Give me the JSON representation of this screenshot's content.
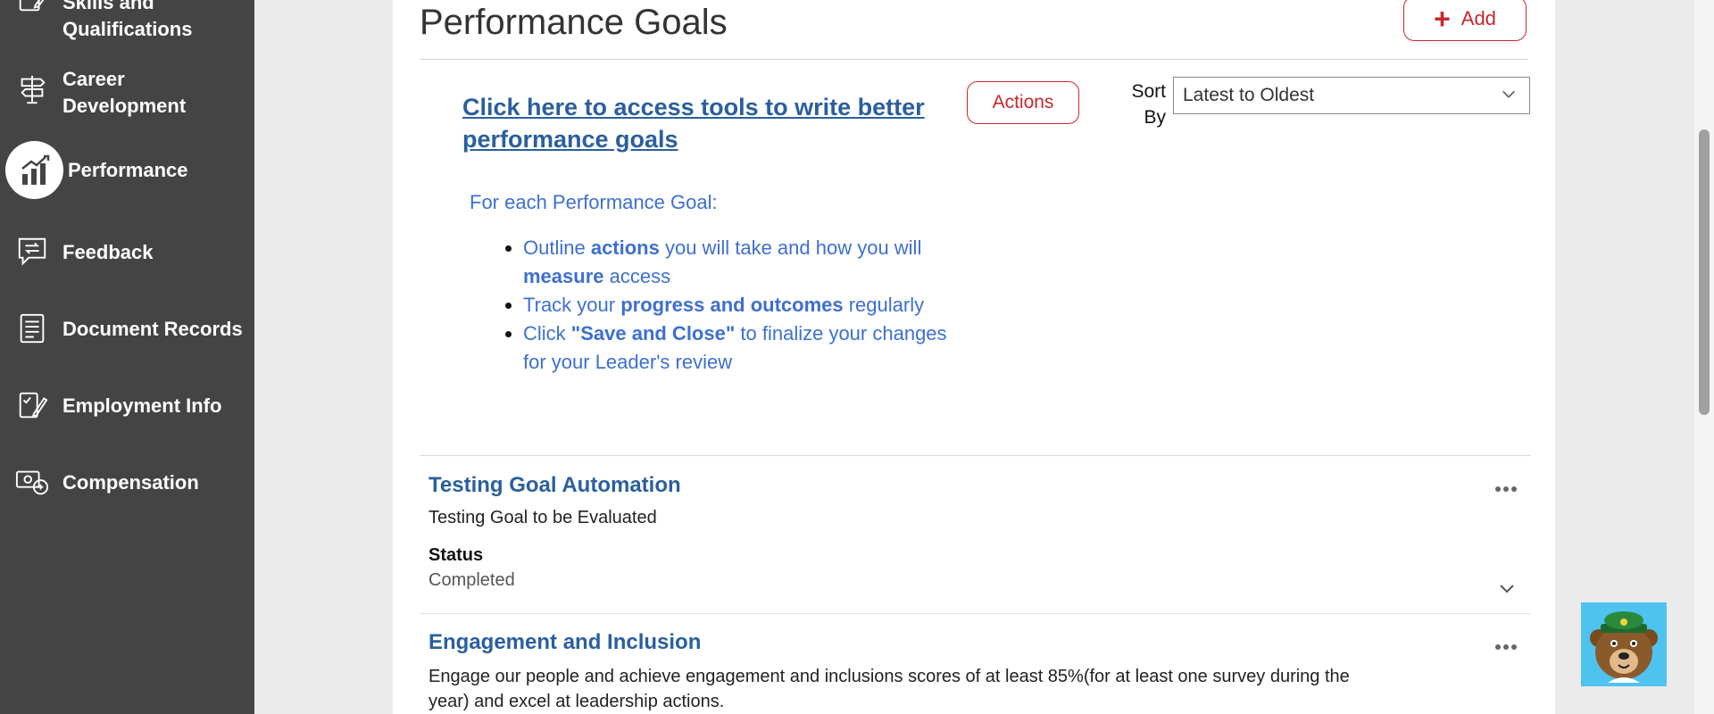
{
  "sidebar": {
    "items": [
      {
        "label": "Skills and Qualifications",
        "icon": "checklist-pencil-icon"
      },
      {
        "label": "Career Development",
        "icon": "signpost-icon"
      },
      {
        "label": "Performance",
        "icon": "bar-chart-icon",
        "active": true
      },
      {
        "label": "Feedback",
        "icon": "chat-feedback-icon"
      },
      {
        "label": "Document Records",
        "icon": "document-icon"
      },
      {
        "label": "Employment Info",
        "icon": "checklist-pencil-icon"
      },
      {
        "label": "Compensation",
        "icon": "money-icon"
      }
    ]
  },
  "main": {
    "title": "Performance Goals",
    "add_label": "Add",
    "tools_link": "Click here to access tools to write better performance goals",
    "actions_label": "Actions",
    "sort": {
      "label": "Sort By",
      "value": "Latest to Oldest"
    },
    "instructions": {
      "heading": "For each Performance Goal:",
      "bullets": [
        {
          "pre": "Outline ",
          "b1": "actions",
          "mid": " you will take and how you will ",
          "b2": "measure",
          "post": " access"
        },
        {
          "pre": "Track your ",
          "b1": "progress and outcomes",
          "post": " regularly"
        },
        {
          "pre": "Click ",
          "b1": "\"Save and Close\"",
          "post": " to finalize your changes for your Leader's review"
        }
      ]
    },
    "goals": [
      {
        "title": "Testing Goal Automation",
        "description": "Testing Goal to be Evaluated",
        "status_label": "Status",
        "status": "Completed"
      },
      {
        "title": "Engagement and Inclusion",
        "description": "Engage our people and achieve engagement and inclusions scores of at least 85%(for at least one survey during the year) and excel at leadership actions."
      }
    ]
  },
  "colors": {
    "sidebar_bg": "#444444",
    "accent_red": "#c8272e",
    "link_blue": "#2a5f9e",
    "instruction_blue": "#3d6fd1"
  }
}
